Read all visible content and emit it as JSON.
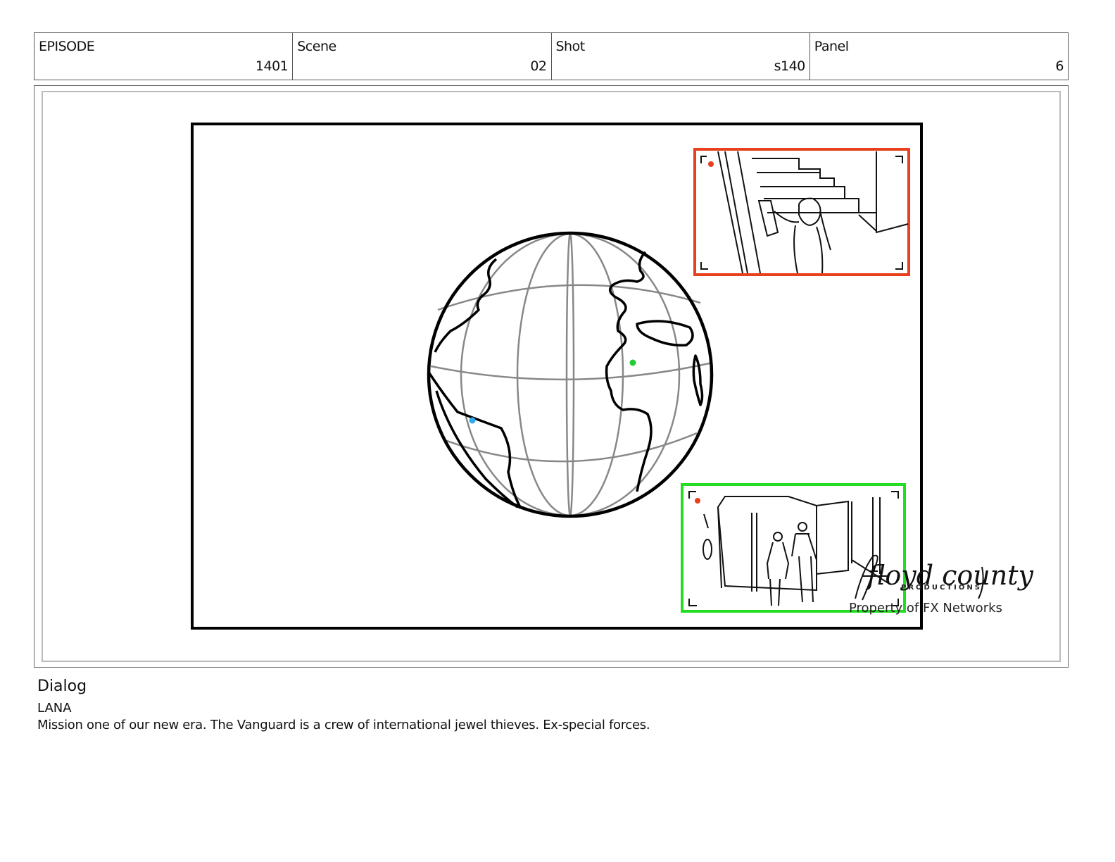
{
  "header": {
    "episode": {
      "label": "EPISODE",
      "value": "1401"
    },
    "scene": {
      "label": "Scene",
      "value": "02"
    },
    "shot": {
      "label": "Shot",
      "value": "s140"
    },
    "panel": {
      "label": "Panel",
      "value": "6"
    }
  },
  "artwork": {
    "subject": "globe-with-inset-shots",
    "inset_top_color": "#e8401c",
    "inset_bottom_color": "#22dd22",
    "marker_colors": [
      "#22cc33",
      "#33aaee",
      "#e8401c"
    ]
  },
  "watermark": {
    "script": "floyd county",
    "sub": "PRODUCTIONS",
    "property": "Property of FX Networks"
  },
  "dialog": {
    "title": "Dialog",
    "speaker": "LANA",
    "line": "Mission one of our new era. The Vanguard is a crew of international jewel thieves. Ex-special forces."
  }
}
